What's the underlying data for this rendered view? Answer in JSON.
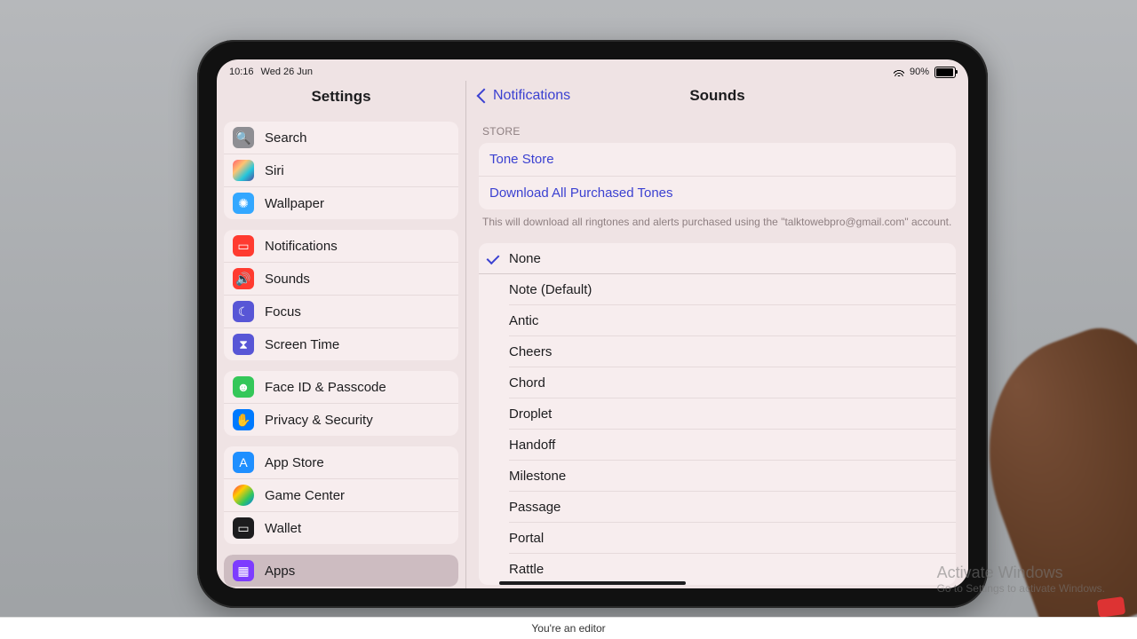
{
  "status": {
    "time": "10:16",
    "date": "Wed 26 Jun",
    "battery_pct": "90%"
  },
  "sidebar": {
    "title": "Settings",
    "groups": [
      [
        {
          "label": "Search",
          "icon": "search-icon"
        },
        {
          "label": "Siri",
          "icon": "siri-icon"
        },
        {
          "label": "Wallpaper",
          "icon": "wallpaper-icon"
        }
      ],
      [
        {
          "label": "Notifications",
          "icon": "notifications-icon"
        },
        {
          "label": "Sounds",
          "icon": "sounds-icon"
        },
        {
          "label": "Focus",
          "icon": "focus-icon"
        },
        {
          "label": "Screen Time",
          "icon": "screen-time-icon"
        }
      ],
      [
        {
          "label": "Face ID & Passcode",
          "icon": "faceid-icon"
        },
        {
          "label": "Privacy & Security",
          "icon": "privacy-icon"
        }
      ],
      [
        {
          "label": "App Store",
          "icon": "app-store-icon"
        },
        {
          "label": "Game Center",
          "icon": "game-center-icon"
        },
        {
          "label": "Wallet",
          "icon": "wallet-icon"
        }
      ],
      [
        {
          "label": "Apps",
          "icon": "apps-icon",
          "selected": true
        }
      ]
    ]
  },
  "detail": {
    "back_label": "Notifications",
    "title": "Sounds",
    "store_header": "STORE",
    "store_links": {
      "tone_store": "Tone Store",
      "download_all": "Download All Purchased Tones"
    },
    "store_footer": "This will download all ringtones and alerts purchased using the \"talktowebpro@gmail.com\" account.",
    "selected_tone": "None",
    "tones": [
      "None",
      "Note (Default)",
      "Antic",
      "Cheers",
      "Chord",
      "Droplet",
      "Handoff",
      "Milestone",
      "Passage",
      "Portal",
      "Rattle"
    ]
  },
  "caption": "You're an editor",
  "watermark": {
    "line1": "Activate Windows",
    "line2": "Go to Settings to activate Windows."
  }
}
